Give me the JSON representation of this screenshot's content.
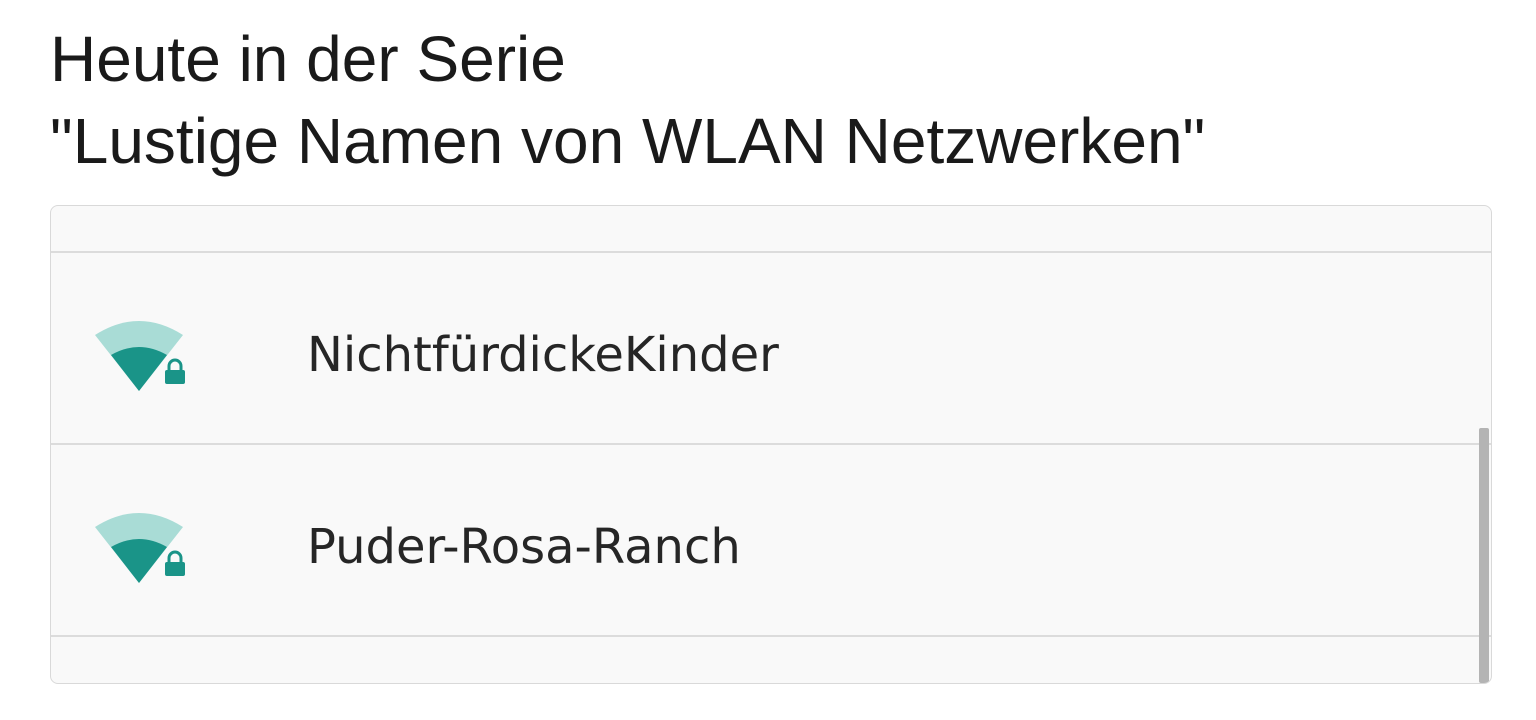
{
  "caption": {
    "line1": "Heute in der Serie",
    "line2": "\"Lustige Namen von WLAN Netzwerken\""
  },
  "networks": [
    {
      "name": "NichtfürdickeKinder",
      "icon": "wifi-locked-icon",
      "signal_level": 0.5,
      "secured": true
    },
    {
      "name": "Puder-Rosa-Ranch",
      "icon": "wifi-locked-icon",
      "signal_level": 0.5,
      "secured": true
    }
  ],
  "colors": {
    "signal_strong": "#1a9488",
    "signal_weak": "#a9dcd6",
    "panel_bg": "#f9f9f9",
    "divider": "#dcdcdc",
    "scrollbar": "#b4b4b4"
  }
}
